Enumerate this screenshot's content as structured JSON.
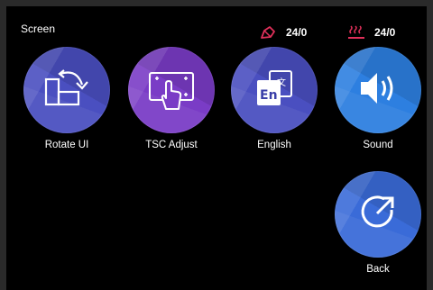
{
  "header": {
    "title": "Screen",
    "nozzle_temp": "24/0",
    "bed_temp": "24/0"
  },
  "colors": {
    "purple_blue": "#4a4fc0",
    "purple": "#7a3cc6",
    "sound_blue": "#2d7fe0",
    "status_icon_red": "#e0305a"
  },
  "buttons": [
    {
      "label": "Rotate UI",
      "icon": "rotate-ui-icon"
    },
    {
      "label": "TSC Adjust",
      "icon": "touch-calibrate-icon"
    },
    {
      "label": "English",
      "icon": "language-icon"
    },
    {
      "label": "Sound",
      "icon": "speaker-icon"
    },
    {
      "label": "Back",
      "icon": "back-arrow-icon"
    }
  ]
}
